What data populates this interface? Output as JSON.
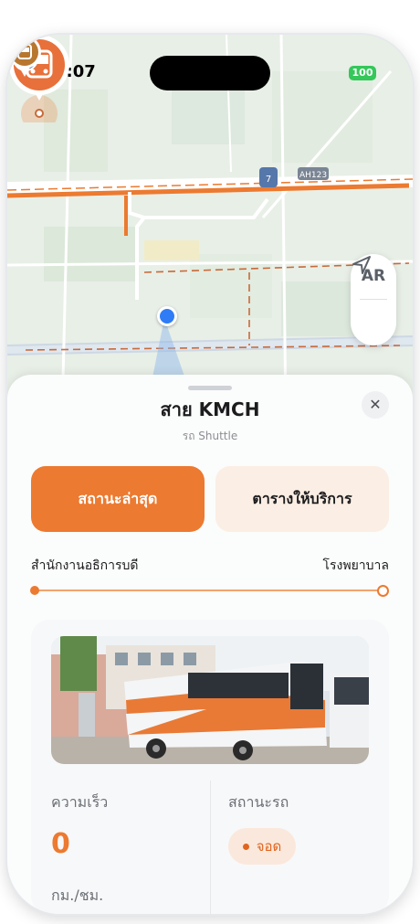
{
  "status_bar": {
    "time": "9:07",
    "battery": "100"
  },
  "map": {
    "road_label_ah": "AH123",
    "road_label_num": "7",
    "buttons": {
      "ar_label": "AR"
    }
  },
  "sheet": {
    "title": "สาย KMCH",
    "subtitle": "รถ Shuttle",
    "close_label": "✕",
    "tabs": [
      {
        "label": "สถานะล่าสุด",
        "active": true
      },
      {
        "label": "ตารางให้บริการ",
        "active": false
      }
    ],
    "route": {
      "from": "สำนักงานอธิการบดี",
      "to": "โรงพยาบาล"
    },
    "vehicle": {
      "speed_label": "ความเร็ว",
      "speed_value": "0",
      "speed_unit": "กม./ชม.",
      "status_label": "สถานะรถ",
      "status_value": "จอด"
    }
  },
  "colors": {
    "accent": "#ec7a30",
    "accent_light": "#fbeee4",
    "user_location": "#2f7cf6"
  }
}
